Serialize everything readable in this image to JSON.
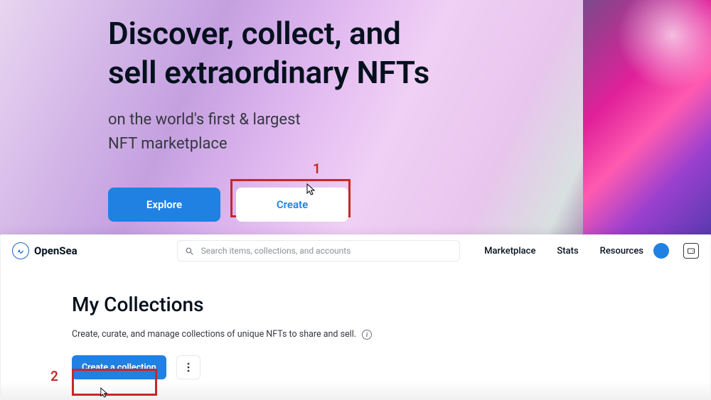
{
  "hero": {
    "title_line1": "Discover, collect, and",
    "title_line2": "sell extraordinary NFTs",
    "subtitle_line1": "on the world's first & largest",
    "subtitle_line2": "NFT marketplace",
    "explore_label": "Explore",
    "create_label": "Create"
  },
  "annotations": {
    "step1": "1",
    "step2": "2"
  },
  "app": {
    "brand": "OpenSea",
    "search": {
      "placeholder": "Search items, collections, and accounts"
    },
    "nav": {
      "marketplace": "Marketplace",
      "stats": "Stats",
      "resources": "Resources"
    },
    "page": {
      "title": "My Collections",
      "description": "Create, curate, and manage collections of unique NFTs to share and sell.",
      "create_collection_label": "Create a collection"
    }
  }
}
